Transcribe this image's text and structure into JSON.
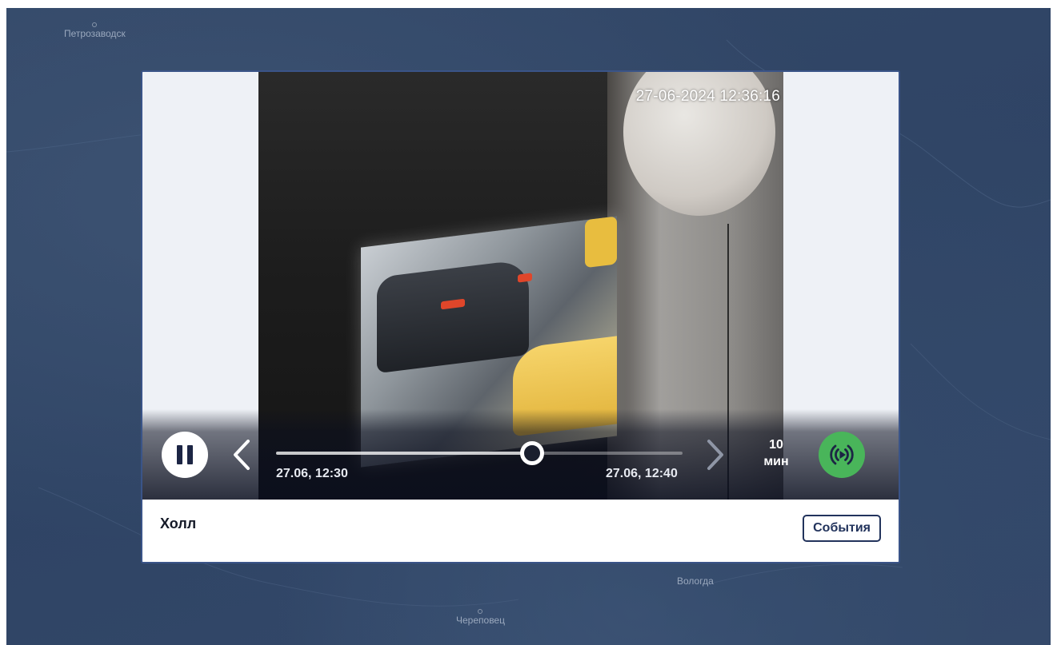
{
  "map": {
    "cities": [
      "Петрозаводск",
      "Вологда",
      "Череповец"
    ]
  },
  "player": {
    "overlay_timestamp": "27-06-2024 12:36:16",
    "timeline": {
      "start_label": "27.06, 12:30",
      "end_label": "27.06, 12:40",
      "position_fraction": 0.63
    },
    "interval": {
      "value": "10",
      "unit": "мин"
    },
    "icons": {
      "pause": "pause-icon",
      "prev": "chevron-left-icon",
      "next": "chevron-right-icon",
      "live": "live-stream-icon"
    },
    "colors": {
      "live_button": "#49b55a",
      "modal_border": "#3a5488",
      "map_background": "#34496a"
    }
  },
  "footer": {
    "camera_name": "Холл",
    "events_button_label": "События"
  }
}
